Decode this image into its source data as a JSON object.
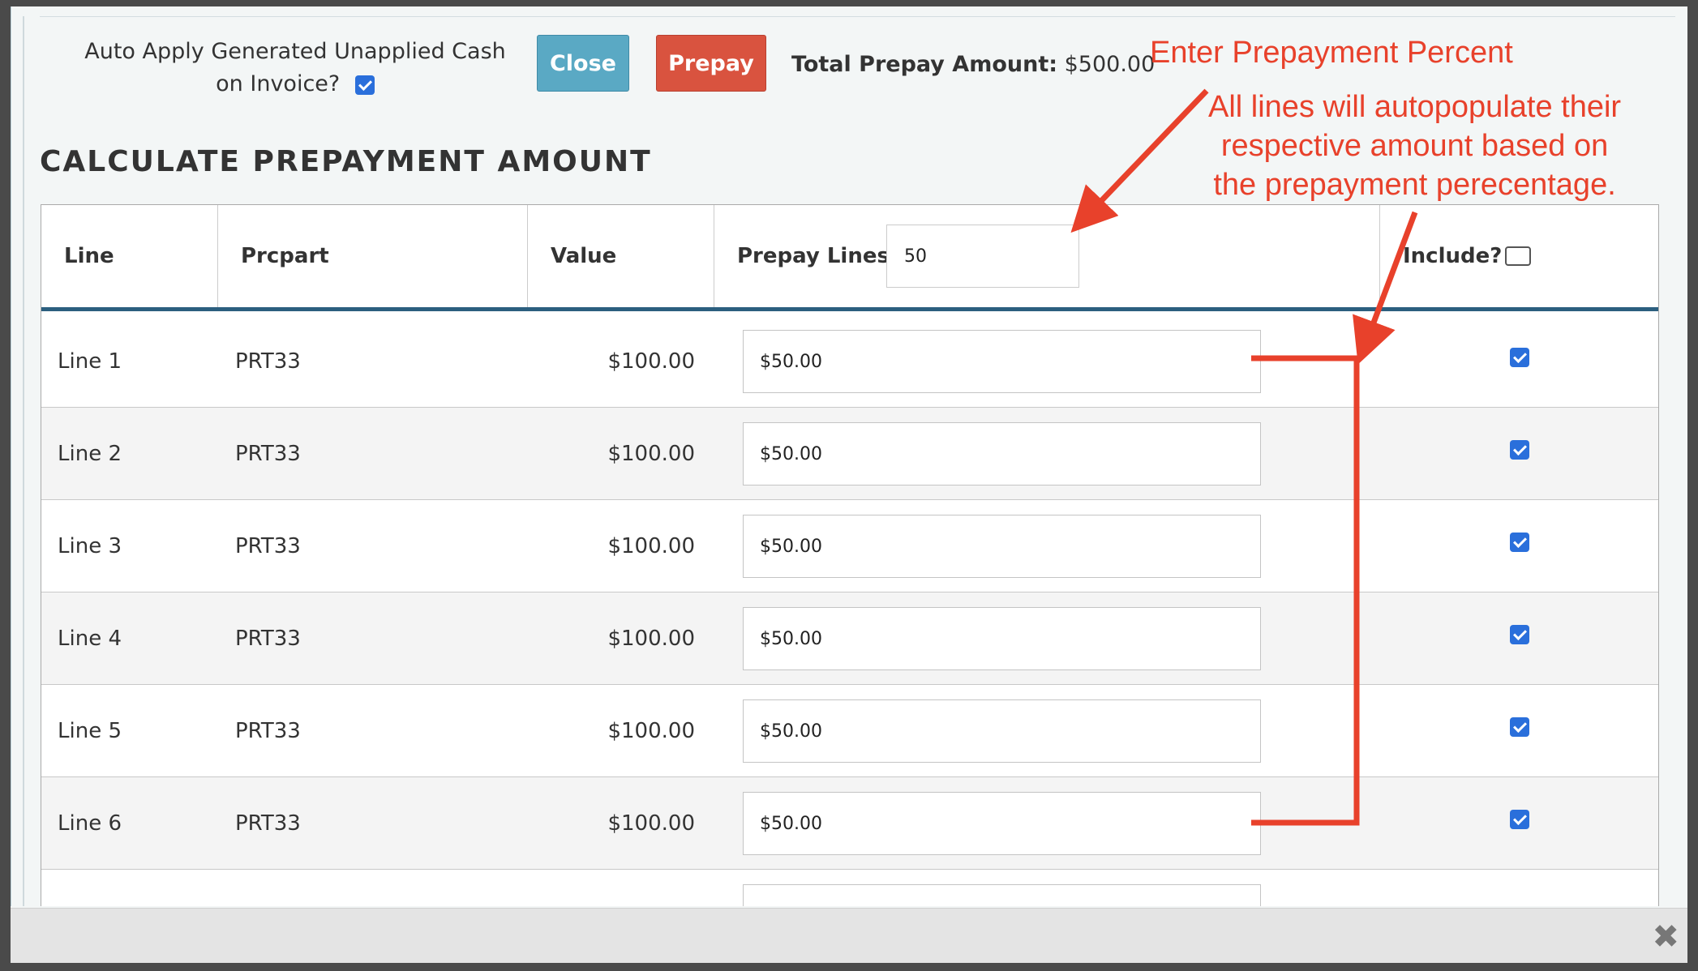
{
  "header": {
    "auto_apply_label": "Auto Apply Generated Unapplied Cash on Invoice?",
    "auto_apply_checked": true,
    "close_label": "Close",
    "prepay_label": "Prepay",
    "total_label": "Total Prepay Amount:",
    "total_value": "$500.00"
  },
  "section_title": "CALCULATE PREPAYMENT AMOUNT",
  "table": {
    "columns": {
      "line": "Line",
      "prcpart": "Prcpart",
      "value": "Value",
      "prepay": "Prepay Lines",
      "include": "Include?"
    },
    "prepay_percent": "50",
    "include_all_checked": false,
    "rows": [
      {
        "line": "Line 1",
        "prcpart": "PRT33",
        "value": "$100.00",
        "amount": "$50.00",
        "include": true
      },
      {
        "line": "Line 2",
        "prcpart": "PRT33",
        "value": "$100.00",
        "amount": "$50.00",
        "include": true
      },
      {
        "line": "Line 3",
        "prcpart": "PRT33",
        "value": "$100.00",
        "amount": "$50.00",
        "include": true
      },
      {
        "line": "Line 4",
        "prcpart": "PRT33",
        "value": "$100.00",
        "amount": "$50.00",
        "include": true
      },
      {
        "line": "Line 5",
        "prcpart": "PRT33",
        "value": "$100.00",
        "amount": "$50.00",
        "include": true
      },
      {
        "line": "Line 6",
        "prcpart": "PRT33",
        "value": "$100.00",
        "amount": "$50.00",
        "include": true
      }
    ]
  },
  "annotations": {
    "enter_percent": "Enter Prepayment Percent",
    "autopopulate_lines": [
      "All lines will autopopulate their",
      "respective amount based on",
      "the prepayment perecentage."
    ],
    "color": "#e8412b"
  },
  "footer": {
    "close_icon": "close-icon"
  }
}
